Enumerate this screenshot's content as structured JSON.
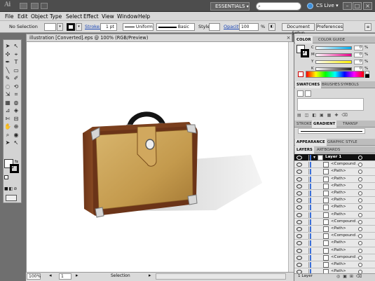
{
  "app": {
    "logo": "Ai",
    "workspace": "ESSENTIALS",
    "cs_live": "CS Live"
  },
  "menu": [
    "File",
    "Edit",
    "Object",
    "Type",
    "Select",
    "Effect",
    "View",
    "Window",
    "Help"
  ],
  "control_bar": {
    "selection_label": "No Selection",
    "stroke_label": "Stroke:",
    "stroke_weight": "1 pt",
    "profile": "Uniform",
    "brush": "Basic",
    "style_label": "Style:",
    "opacity_label": "Opacity:",
    "opacity_value": "100",
    "opacity_unit": "%",
    "document_setup": "Document Setup",
    "preferences": "Preferences"
  },
  "document": {
    "tab_title": "illustration [Converted].eps @ 100% (RGB/Preview)",
    "zoom": "100%",
    "artboard": "1",
    "status": "Selection"
  },
  "color_panel": {
    "tabs": [
      "COLOR",
      "COLOR GUIDE"
    ],
    "channels": [
      {
        "name": "C",
        "value": "0",
        "color": "#00aeef"
      },
      {
        "name": "M",
        "value": "0",
        "color": "#ec008c"
      },
      {
        "name": "Y",
        "value": "0",
        "color": "#fff200"
      },
      {
        "name": "K",
        "value": "0",
        "color": "#231f20"
      }
    ],
    "unit": "%"
  },
  "swatches_panel": {
    "tabs": [
      "SWATCHES",
      "BRUSHES",
      "SYMBOLS"
    ]
  },
  "stroke_panel": {
    "tabs": [
      "STROKE",
      "GRADIENT",
      "TRANSP"
    ]
  },
  "appearance_panel": {
    "tabs": [
      "APPEARANCE",
      "GRAPHIC STYLE"
    ]
  },
  "layers_panel": {
    "tabs": [
      "LAYERS",
      "ARTBOARDS"
    ],
    "rows": [
      {
        "name": "Layer 1",
        "selected": true
      },
      {
        "name": "<Compound ..."
      },
      {
        "name": "<Path>"
      },
      {
        "name": "<Path>"
      },
      {
        "name": "<Path>"
      },
      {
        "name": "<Path>"
      },
      {
        "name": "<Path>"
      },
      {
        "name": "<Path>"
      },
      {
        "name": "<Path>"
      },
      {
        "name": "<Compound ..."
      },
      {
        "name": "<Path>"
      },
      {
        "name": "<Compound ..."
      },
      {
        "name": "<Path>"
      },
      {
        "name": "<Path>"
      },
      {
        "name": "<Compound ..."
      },
      {
        "name": "<Path>"
      },
      {
        "name": "<Path>"
      }
    ],
    "footer": "1 Layer"
  }
}
